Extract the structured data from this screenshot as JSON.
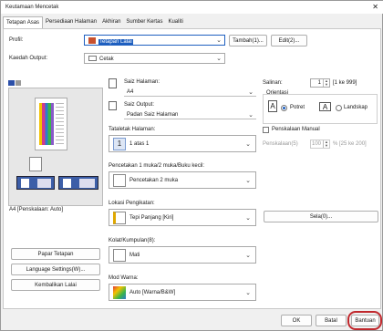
{
  "window": {
    "title": "Keutamaan Mencetak",
    "close": "✕"
  },
  "tabs": [
    {
      "label": "Tetapan Asas"
    },
    {
      "label": "Persediaan Halaman"
    },
    {
      "label": "Akhiran"
    },
    {
      "label": "Sumber Kertas"
    },
    {
      "label": "Kualiti"
    }
  ],
  "profile": {
    "label": "Profil:",
    "value": "Tetapan Lalai",
    "add_btn": "Tambah(1)...",
    "edit_btn": "Edit(2)..."
  },
  "output": {
    "label": "Kaedah Output:",
    "value": "Cetak"
  },
  "preview": {
    "caption": "A4 [Penskalaan: Auto]"
  },
  "left_buttons": {
    "default_paper": "Papar Tetapan",
    "language": "Language Settings(W)...",
    "restore": "Kembalikan Lalai"
  },
  "page_size": {
    "label": "Saiz Halaman:",
    "value": "A4"
  },
  "output_size": {
    "label": "Saiz Output:",
    "value": "Padan Saiz Halaman"
  },
  "layout": {
    "label": "Tataletak Halaman:",
    "value": "1 atas 1",
    "icon": "1"
  },
  "nup": {
    "label": "Pencetakan 1 muka/2 muka/Buku kecil:",
    "value": "Pencetakan 2 muka"
  },
  "binding": {
    "label": "Lokasi Pengikatan:",
    "value": "Tepi Panjang [Kiri]"
  },
  "collate": {
    "label": "Kolat/Kumpulan(8):",
    "value": "Mati"
  },
  "color_mode": {
    "label": "Mod Warna:",
    "value": "Auto [Warna/B&W]"
  },
  "copies": {
    "label": "Salinan:",
    "value": "1",
    "range": "[1 ke 999]"
  },
  "orientation": {
    "label": "Orientasi",
    "portrait": "Potret",
    "landscape": "Landskap"
  },
  "scaling": {
    "label": "Penskalaan Manual",
    "field_label": "Penskalaan(5)",
    "value": "100",
    "range": "% [25 ke 200]"
  },
  "edit_btn": {
    "label": "Sela(0)..."
  },
  "footer": {
    "ok": "OK",
    "cancel": "Batal",
    "help": "Bantuan"
  },
  "colors": {
    "accent": "#1e5fbf",
    "help_ring": "#c0282d"
  }
}
